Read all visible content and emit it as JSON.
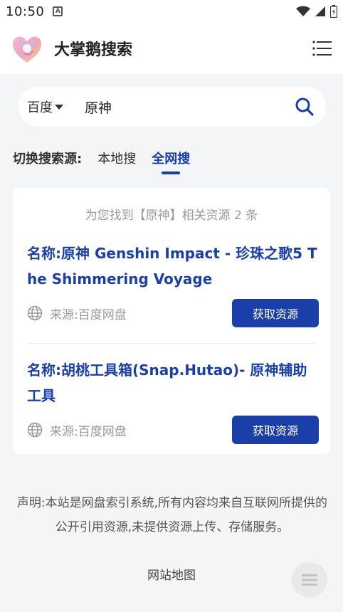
{
  "status_bar": {
    "time": "10:50",
    "notification_badge": "A"
  },
  "header": {
    "title": "大掌鹅搜索"
  },
  "search": {
    "engine": "百度",
    "query": "原神"
  },
  "source_switch": {
    "label": "切换搜索源:",
    "tabs": [
      {
        "label": "本地搜",
        "active": false
      },
      {
        "label": "全网搜",
        "active": true
      }
    ]
  },
  "results": {
    "summary": "为您找到【原神】相关资源 2 条",
    "items": [
      {
        "title": "名称:原神 Genshin Impact - 珍珠之歌5 The Shimmering Voyage",
        "source": "来源:百度网盘",
        "button": "获取资源"
      },
      {
        "title": "名称:胡桃工具箱(Snap.Hutao)- 原神辅助工具",
        "source": "来源:百度网盘",
        "button": "获取资源"
      }
    ]
  },
  "footer": {
    "disclaimer": "声明:本站是网盘索引系统,所有内容均来自互联网所提供的公开引用资源,未提供资源上传、存储服务。",
    "sitemap": "网站地图"
  },
  "colors": {
    "accent": "#1a3fa8",
    "muted": "#999999",
    "background": "#f4f5f7"
  }
}
